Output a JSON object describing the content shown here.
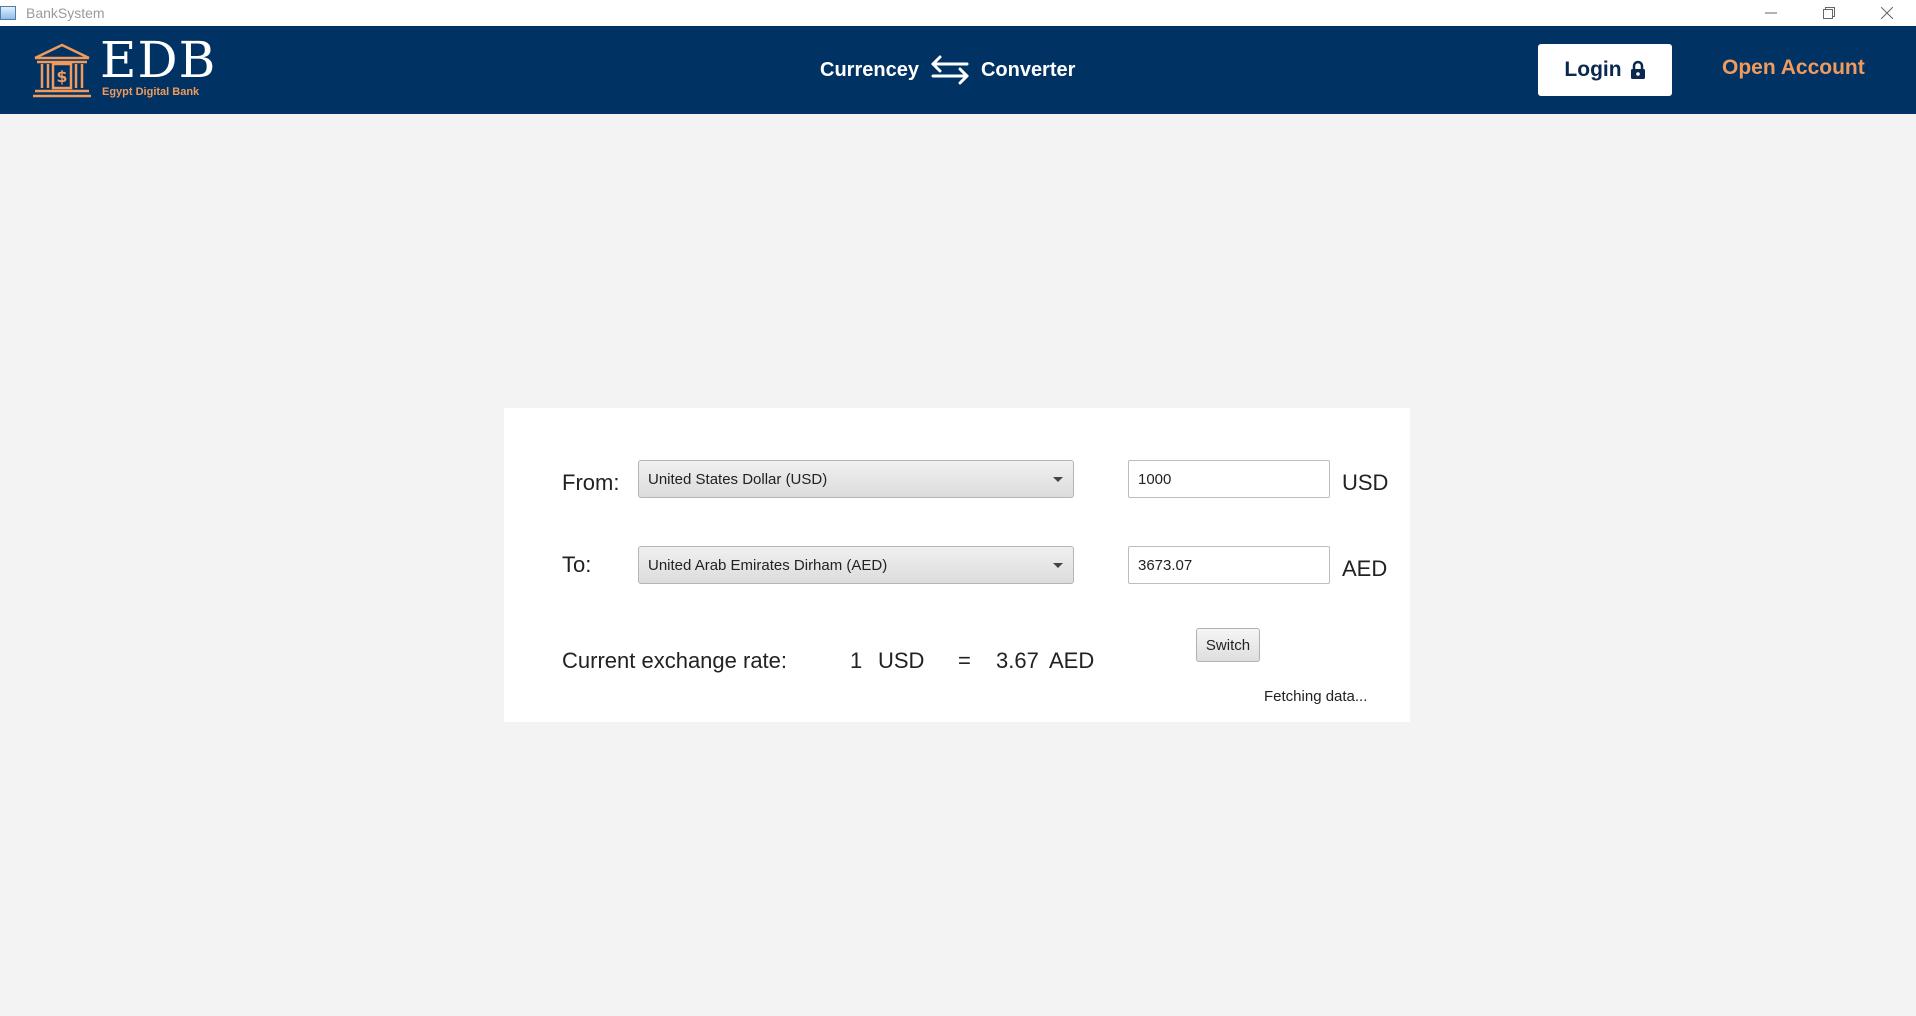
{
  "window": {
    "title": "BankSystem"
  },
  "header": {
    "logo_text": "EDB",
    "logo_subtitle": "Egypt Digital Bank",
    "center_left": "Currencey",
    "center_right": "Converter",
    "login_label": "Login",
    "open_account_label": "Open Account"
  },
  "converter": {
    "from_label": "From:",
    "to_label": "To:",
    "from_currency": "United States Dollar (USD)",
    "to_currency": "United Arab Emirates Dirham (AED)",
    "from_amount": "1000",
    "to_amount": "3673.07",
    "from_unit": "USD",
    "to_unit": "AED",
    "rate_label": "Current exchange rate:",
    "rate_one": "1",
    "rate_from_unit": "USD",
    "rate_equals": "=",
    "rate_value": "3.67",
    "rate_to_unit": "AED",
    "switch_label": "Switch",
    "status_text": "Fetching data..."
  },
  "colors": {
    "header_bg": "#003363",
    "accent": "#f29a5b",
    "page_bg": "#f3f3f3"
  }
}
